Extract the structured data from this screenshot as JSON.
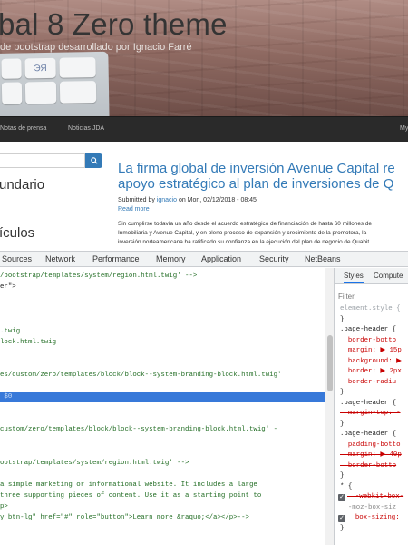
{
  "site": {
    "title": "bal 8 Zero theme",
    "slogan": "de bootstrap desarrollado por Ignacio Farré",
    "keyboard_keys": [
      "",
      "",
      "",
      "ЭЯ",
      "",
      ""
    ]
  },
  "navbar": {
    "items": [
      "Notas de prensa",
      "Noticias JDA",
      "My"
    ]
  },
  "sidebar": {
    "headings": [
      "undario",
      "ículos"
    ]
  },
  "article": {
    "title_line1": "La firma global de inversión Avenue Capital re",
    "title_line2": "apoyo estratégico al plan de inversiones de Q",
    "submitted_prefix": "Submitted by ",
    "author": "ignacio",
    "submitted_suffix": " on Mon, 02/12/2018 - 08:45",
    "read_more": "Read more",
    "body_lines": [
      "Sin cumplirse todavía un año desde el acuerdo estratégico de financiación de hasta 60 millones de",
      "Inmobiliaria y Avenue Capital, y en pleno proceso de expansión y crecimiento de la promotora, la",
      "inversión norteamericana ha ratificado su confianza en la ejecución del plan de negocio de Quabit"
    ]
  },
  "devtools": {
    "tabs": [
      "Sources",
      "Network",
      "Performance",
      "Memory",
      "Application",
      "Security",
      "NetBeans"
    ],
    "elements_lines": [
      {
        "text": "/bootstrap/templates/system/region.html.twig' -->",
        "kind": "comment"
      },
      {
        "text": "er\">",
        "kind": "code"
      },
      {
        "text": "",
        "kind": "code"
      },
      {
        "text": "",
        "kind": "code"
      },
      {
        "text": "",
        "kind": "code"
      },
      {
        "text": ".twig",
        "kind": "comment"
      },
      {
        "text": "lock.html.twig",
        "kind": "comment"
      },
      {
        "text": "",
        "kind": "code"
      },
      {
        "text": "",
        "kind": "code"
      },
      {
        "text": "es/custom/zero/templates/block/block--system-branding-block.html.twig'",
        "kind": "comment"
      },
      {
        "text": "",
        "kind": "code"
      },
      {
        "text": " $0",
        "kind": "selected"
      },
      {
        "text": "",
        "kind": "code"
      },
      {
        "text": "",
        "kind": "code"
      },
      {
        "text": "custom/zero/templates/block/block--system-branding-block.html.twig' -",
        "kind": "comment"
      },
      {
        "text": "",
        "kind": "code"
      },
      {
        "text": "",
        "kind": "code"
      },
      {
        "text": "ootstrap/templates/system/region.html.twig' -->",
        "kind": "comment"
      },
      {
        "text": "",
        "kind": "code"
      },
      {
        "text": "a simple marketing or informational website. It includes a large",
        "kind": "comment"
      },
      {
        "text": "three supporting pieces of content. Use it as a starting point to",
        "kind": "comment"
      },
      {
        "text": "p>",
        "kind": "comment"
      },
      {
        "text": "y btn-lg\" href=\"#\" role=\"button\">Learn more &raquo;</a></p>-->",
        "kind": "comment"
      }
    ],
    "styles": {
      "tabs": [
        "Styles",
        "Compute"
      ],
      "filter_placeholder": "Filter",
      "lines": [
        {
          "text": "element.style {",
          "kind": "gray"
        },
        {
          "text": "}",
          "kind": "code"
        },
        {
          "text": ".page-header {",
          "kind": "code"
        },
        {
          "text": "  border-botto",
          "kind": "prop"
        },
        {
          "text": "  margin: ▶ 15p",
          "kind": "prop"
        },
        {
          "text": "  background: ▶",
          "kind": "prop"
        },
        {
          "text": "  border: ▶ 2px",
          "kind": "prop"
        },
        {
          "text": "  border-radiu",
          "kind": "prop"
        },
        {
          "text": "}",
          "kind": "code"
        },
        {
          "text": ".page-header {",
          "kind": "code"
        },
        {
          "text": "  margin-top: -",
          "kind": "struck"
        },
        {
          "text": "}",
          "kind": "code"
        },
        {
          "text": ".page-header {",
          "kind": "code"
        },
        {
          "text": "  padding-botto",
          "kind": "prop"
        },
        {
          "text": "  margin: ▶ 40p",
          "kind": "struck"
        },
        {
          "text": "  border-botto",
          "kind": "struck"
        },
        {
          "text": "}",
          "kind": "code"
        },
        {
          "text": "* {",
          "kind": "code"
        },
        {
          "text": "  -webkit-box-",
          "kind": "struck"
        },
        {
          "text": "  -moz-box-siz",
          "kind": "dim"
        },
        {
          "text": "  box-sizing: ",
          "kind": "prop"
        },
        {
          "text": "}",
          "kind": "code"
        }
      ]
    }
  }
}
